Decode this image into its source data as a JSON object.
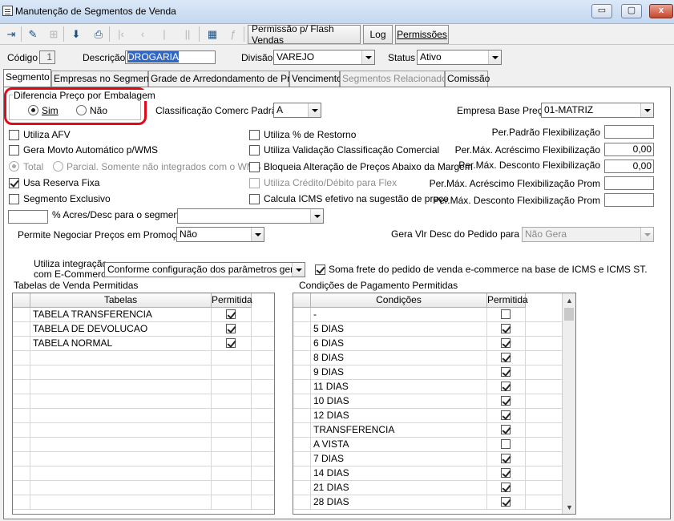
{
  "window": {
    "title": "Manutenção de Segmentos de Venda",
    "min": "▭",
    "max": "▢",
    "close": "x"
  },
  "toolbar": {
    "buttons": [
      {
        "icon": "exit-icon",
        "glyph": "⇥",
        "enabled": true
      },
      {
        "icon": "pencil-icon",
        "glyph": "✎",
        "enabled": true
      },
      {
        "icon": "tree-icon",
        "glyph": "⊞",
        "enabled": false
      },
      {
        "icon": "save-icon",
        "glyph": "⬇",
        "enabled": true
      },
      {
        "icon": "print-icon",
        "glyph": "⎙",
        "enabled": true
      },
      {
        "icon": "first-icon",
        "glyph": "|‹",
        "enabled": false
      },
      {
        "icon": "prev-icon",
        "glyph": "‹",
        "enabled": false
      },
      {
        "icon": "next-icon",
        "glyph": "|",
        "enabled": false
      },
      {
        "icon": "last-icon",
        "glyph": "||",
        "enabled": false
      },
      {
        "icon": "grid-icon",
        "glyph": "▦",
        "enabled": true
      },
      {
        "icon": "function-icon",
        "glyph": "ƒ",
        "enabled": false
      }
    ],
    "flash_sales_permission": "Permissão p/ Flash Vendas",
    "log": "Log",
    "permissions": "Permissões"
  },
  "header": {
    "codigo_label": "Código",
    "codigo_value": "1",
    "descricao_label": "Descrição",
    "descricao_value": "DROGARIA",
    "divisao_label": "Divisão",
    "divisao_value": "VAREJO",
    "status_label": "Status",
    "status_value": "Ativo"
  },
  "tabs": [
    {
      "label": "Segmento",
      "active": true,
      "enabled": true
    },
    {
      "label": "Empresas no Segmento",
      "active": false,
      "enabled": true
    },
    {
      "label": "Grade de Arredondamento de Preço",
      "active": false,
      "enabled": true
    },
    {
      "label": "Vencimento",
      "active": false,
      "enabled": true
    },
    {
      "label": "Segmentos Relacionados",
      "active": false,
      "enabled": false
    },
    {
      "label": "Comissão",
      "active": false,
      "enabled": true
    }
  ],
  "segmento": {
    "diferencia_group_label": "Diferencia Preço por Embalagem",
    "sim_label": "Sim",
    "nao_label": "Não",
    "diferencia_selected": "Sim",
    "classificacao_label": "Classificação Comerc Padrão",
    "classificacao_value": "A",
    "empresa_base_label": "Empresa Base Preço",
    "empresa_base_value": "01-MATRIZ",
    "utiliza_afv": {
      "label": "Utiliza AFV",
      "checked": false
    },
    "gera_movto": {
      "label": "Gera Movto Automático p/WMS",
      "checked": false
    },
    "total_label": "Total",
    "parcial_label": "Parcial. Somente não integrados com o WMS",
    "usa_reserva": {
      "label": "Usa Reserva Fixa",
      "checked": true
    },
    "segmento_exclusivo": {
      "label": "Segmento Exclusivo",
      "checked": false
    },
    "utiliza_restorno": {
      "label": "Utiliza % de Restorno",
      "checked": false
    },
    "utiliza_validacao": {
      "label": "Utiliza Validação Classificação Comercial",
      "checked": false
    },
    "bloqueia_alteracao": {
      "label": "Bloqueia Alteração de Preços Abaixo da Margem",
      "checked": false
    },
    "utiliza_credito": {
      "label": "Utiliza Crédito/Débito para Flex",
      "checked": false
    },
    "calcula_icms": {
      "label": "Calcula ICMS efetivo na sugestão de preço",
      "checked": false
    },
    "per_padrao_label": "Per.Padrão Flexibilização",
    "per_padrao_value": "",
    "per_max_acrescimo_label": "Per.Máx. Acréscimo Flexibilização",
    "per_max_acrescimo_value": "0,00",
    "per_max_desconto_label": "Per.Máx. Desconto Flexibilização",
    "per_max_desconto_value": "0,00",
    "per_max_acrescimo_prom_label": "Per.Máx. Acréscimo Flexibilização Prom",
    "per_max_acrescimo_prom_value": "",
    "per_max_desconto_prom_label": "Per.Máx. Desconto Flexibilização Prom",
    "per_max_desconto_prom_value": "",
    "acres_desc_label": "% Acres/Desc para o segmento",
    "acres_desc_value": "",
    "acres_desc_combo": "",
    "permite_negociar_label": "Permite Negociar Preços em Promoção",
    "permite_negociar_value": "Não",
    "gera_vlr_desc_label": "Gera Vlr Desc do Pedido para NF",
    "gera_vlr_desc_value": "Não Gera",
    "ecommerce_label_1": "Utiliza integração",
    "ecommerce_label_2": "com E-Commerce",
    "ecommerce_value": "Conforme configuração dos parâmetros gerais",
    "soma_frete": {
      "label": "Soma frete do pedido de venda e-commerce na base de ICMS e ICMS ST.",
      "checked": true
    }
  },
  "tabelas": {
    "title": "Tabelas de Venda Permitidas",
    "col_tabelas": "Tabelas",
    "col_permitida": "Permitida",
    "rows": [
      {
        "name": "TABELA TRANSFERENCIA",
        "checked": true
      },
      {
        "name": "TABELA DE DEVOLUCAO",
        "checked": true
      },
      {
        "name": "TABELA NORMAL",
        "checked": true
      }
    ],
    "empty_rows": 11
  },
  "condicoes": {
    "title": "Condições de Pagamento Permitidas",
    "col_condicoes": "Condições",
    "col_permitida": "Permitida",
    "rows": [
      {
        "name": "-",
        "checked": false
      },
      {
        "name": "5 DIAS",
        "checked": true
      },
      {
        "name": "6 DIAS",
        "checked": true
      },
      {
        "name": "8 DIAS",
        "checked": true
      },
      {
        "name": "9 DIAS",
        "checked": true
      },
      {
        "name": "11 DIAS",
        "checked": true
      },
      {
        "name": "10 DIAS",
        "checked": true
      },
      {
        "name": "12 DIAS",
        "checked": true
      },
      {
        "name": "TRANSFERENCIA",
        "checked": true
      },
      {
        "name": "A VISTA",
        "checked": false
      },
      {
        "name": "7 DIAS",
        "checked": true
      },
      {
        "name": "14 DIAS",
        "checked": true
      },
      {
        "name": "21 DIAS",
        "checked": true
      },
      {
        "name": "28 DIAS",
        "checked": true
      }
    ]
  },
  "colors": {
    "highlight": "#3166c4",
    "annotation_red": "#e20a1a"
  }
}
